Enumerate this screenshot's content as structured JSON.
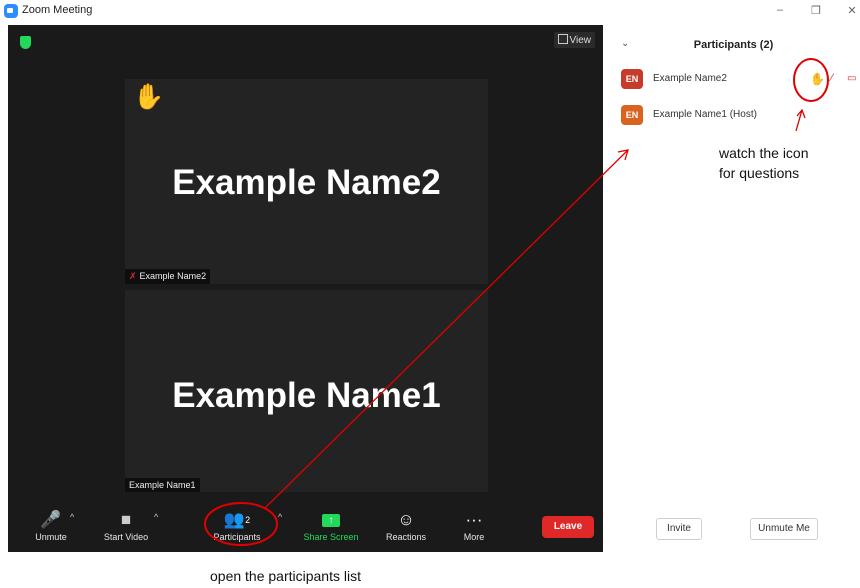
{
  "window": {
    "title": "Zoom Meeting",
    "controls": [
      "–",
      "❐",
      "✕"
    ]
  },
  "video": {
    "view_label": "View",
    "tiles": [
      {
        "name": "Example Name2",
        "label": "Example Name2",
        "hand": "✋",
        "mic_muted_icon": "✗"
      },
      {
        "name": "Example Name1",
        "label": "Example Name1"
      }
    ]
  },
  "toolbar": {
    "unmute_label": "Unmute",
    "start_video_label": "Start Video",
    "participants_label": "Participants",
    "participants_count": "2",
    "share_screen_label": "Share Screen",
    "reactions_label": "Reactions",
    "more_label": "More",
    "leave_label": "Leave",
    "icons": {
      "mic": "🎤",
      "video": "■",
      "participants": "👥",
      "share": "↑",
      "reactions": "☺",
      "more": "···",
      "caret": "^"
    }
  },
  "panel": {
    "title": "Participants (2)",
    "collapse_icon": "⌄",
    "participants": [
      {
        "initials": "EN",
        "name": "Example Name2",
        "avatar_color": "#c53c2b",
        "hand": "✋",
        "mic_icon": "⁄",
        "video_icon": "▭"
      },
      {
        "initials": "EN",
        "name": "Example Name1 (Host)",
        "avatar_color": "#d9641f"
      }
    ],
    "invite_label": "Invite",
    "unmute_me_label": "Unmute Me"
  },
  "annotations": {
    "icon_note_line1": "watch the icon",
    "icon_note_line2": "for questions",
    "list_note": "open the participants list",
    "color": "#e00000"
  },
  "colors": {
    "accent_green": "#23d959",
    "leave_red": "#e02828",
    "video_bg": "#1a1a1a",
    "tile_bg": "#232323",
    "zoom_blue": "#2d8cff"
  }
}
